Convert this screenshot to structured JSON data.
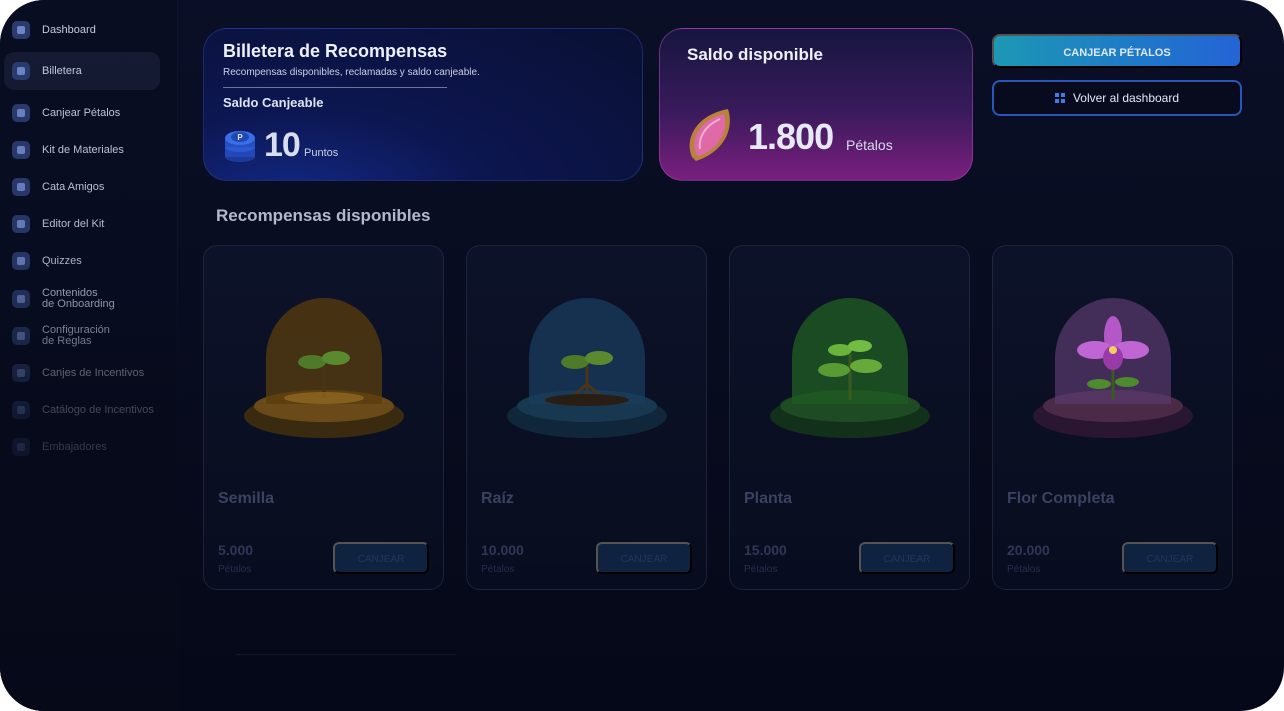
{
  "sidebar": {
    "items": [
      {
        "label": "Dashboard",
        "icon": "grid-icon",
        "active": false
      },
      {
        "label": "Billetera",
        "icon": "wallet-icon",
        "active": true
      },
      {
        "label": "Canjear Pétalos",
        "icon": "user-icon",
        "active": false
      },
      {
        "label": "Kit de Materiales",
        "icon": "users-icon",
        "active": false
      },
      {
        "label": "Cata Amigos",
        "icon": "friends-icon",
        "active": false
      },
      {
        "label": "Editor del Kit",
        "icon": "edit-icon",
        "active": false
      },
      {
        "label": "Quizzes",
        "icon": "quiz-icon",
        "active": false
      },
      {
        "label": "Contenidos\nde Onboarding",
        "icon": "content-icon",
        "active": false
      },
      {
        "label": "Configuración\nde Reglas",
        "icon": "settings-icon",
        "active": false
      },
      {
        "label": "Canjes de Incentivos",
        "icon": "exchange-icon",
        "active": false
      },
      {
        "label": "Catálogo de Incentivos",
        "icon": "catalog-icon",
        "active": false
      },
      {
        "label": "Embajadores",
        "icon": "ambassador-icon",
        "active": false
      }
    ]
  },
  "wallet": {
    "title": "Billetera de Recompensas",
    "subtitle": "Recompensas disponibles, reclamadas y saldo canjeable.",
    "label": "Saldo Canjeable",
    "amount": "10",
    "unit": "Puntos"
  },
  "balance": {
    "title": "Saldo disponible",
    "amount": "1.800",
    "unit": "Pétalos"
  },
  "actions": {
    "redeem_label": "CANJEAR PÉTALOS",
    "back_label": "Volver al dashboard"
  },
  "rewards": {
    "section_title": "Recompensas disponibles",
    "items": [
      {
        "name": "Semilla",
        "desc": "",
        "price": "5.000",
        "unit": "Pétalos",
        "button": "CANJEAR",
        "color": "#d9a33a"
      },
      {
        "name": "Raíz",
        "desc": "",
        "price": "10.000",
        "unit": "Pétalos",
        "button": "CANJEAR",
        "color": "#3a8cc9"
      },
      {
        "name": "Planta",
        "desc": "",
        "price": "15.000",
        "unit": "Pétalos",
        "button": "CANJEAR",
        "color": "#3fb83a"
      },
      {
        "name": "Flor Completa",
        "desc": "",
        "price": "20.000",
        "unit": "Pétalos",
        "button": "CANJEAR",
        "color": "#c56ad6"
      }
    ]
  },
  "colors": {
    "accent": "#1e78c9",
    "balance_glow": "#7a1f7e",
    "wallet_glow": "#132a8a"
  }
}
